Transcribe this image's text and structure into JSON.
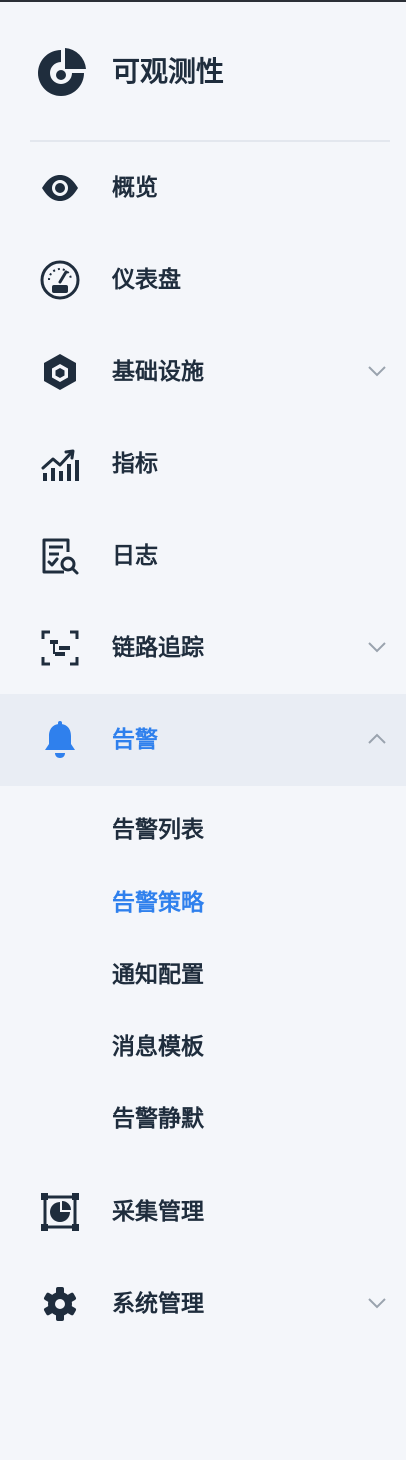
{
  "brand": {
    "title": "可观测性",
    "logo_icon": "donut-chart-icon"
  },
  "menu": {
    "overview": {
      "label": "概览",
      "icon": "eye-icon"
    },
    "dashboard": {
      "label": "仪表盘",
      "icon": "gauge-icon"
    },
    "infrastructure": {
      "label": "基础设施",
      "icon": "cube-icon",
      "expanded": false
    },
    "metrics": {
      "label": "指标",
      "icon": "chart-up-icon"
    },
    "logs": {
      "label": "日志",
      "icon": "log-search-icon"
    },
    "tracing": {
      "label": "链路追踪",
      "icon": "trace-icon",
      "expanded": false
    },
    "alerts": {
      "label": "告警",
      "icon": "bell-icon",
      "expanded": true,
      "children": [
        {
          "label": "告警列表"
        },
        {
          "label": "告警策略",
          "selected": true
        },
        {
          "label": "通知配置"
        },
        {
          "label": "消息模板"
        },
        {
          "label": "告警静默"
        }
      ]
    },
    "collection": {
      "label": "采集管理",
      "icon": "collect-icon"
    },
    "system": {
      "label": "系统管理",
      "icon": "gear-icon",
      "expanded": false
    }
  },
  "colors": {
    "accent": "#2f80ed",
    "text": "#1f2d3d",
    "active_bg": "#e9edf4",
    "bg": "#f4f6fa"
  }
}
